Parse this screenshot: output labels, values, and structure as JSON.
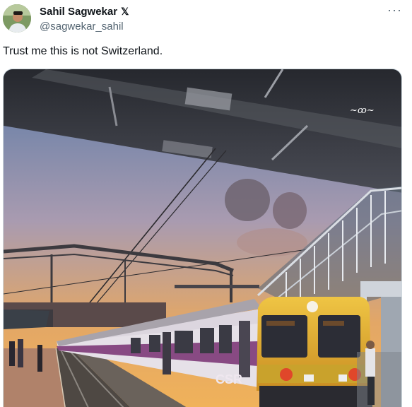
{
  "author": {
    "display_name": "Sahil Sagwekar",
    "verified_mark": "𝕏",
    "handle": "@sagwekar_sahil",
    "avatar_icon": "profile-photo"
  },
  "menu": {
    "more_label": "···"
  },
  "tweet": {
    "text": "Trust me this is not Switzerland."
  },
  "media": {
    "description_icon": "photo-train-platform-sunset",
    "train_number_display": "CSR",
    "colors": {
      "sky_top": "#5f7fa8",
      "sky_bottom": "#e8a455",
      "train_body": "#e9e4ea",
      "train_stripe": "#7d3a78",
      "train_front": "#e7b12f"
    }
  }
}
